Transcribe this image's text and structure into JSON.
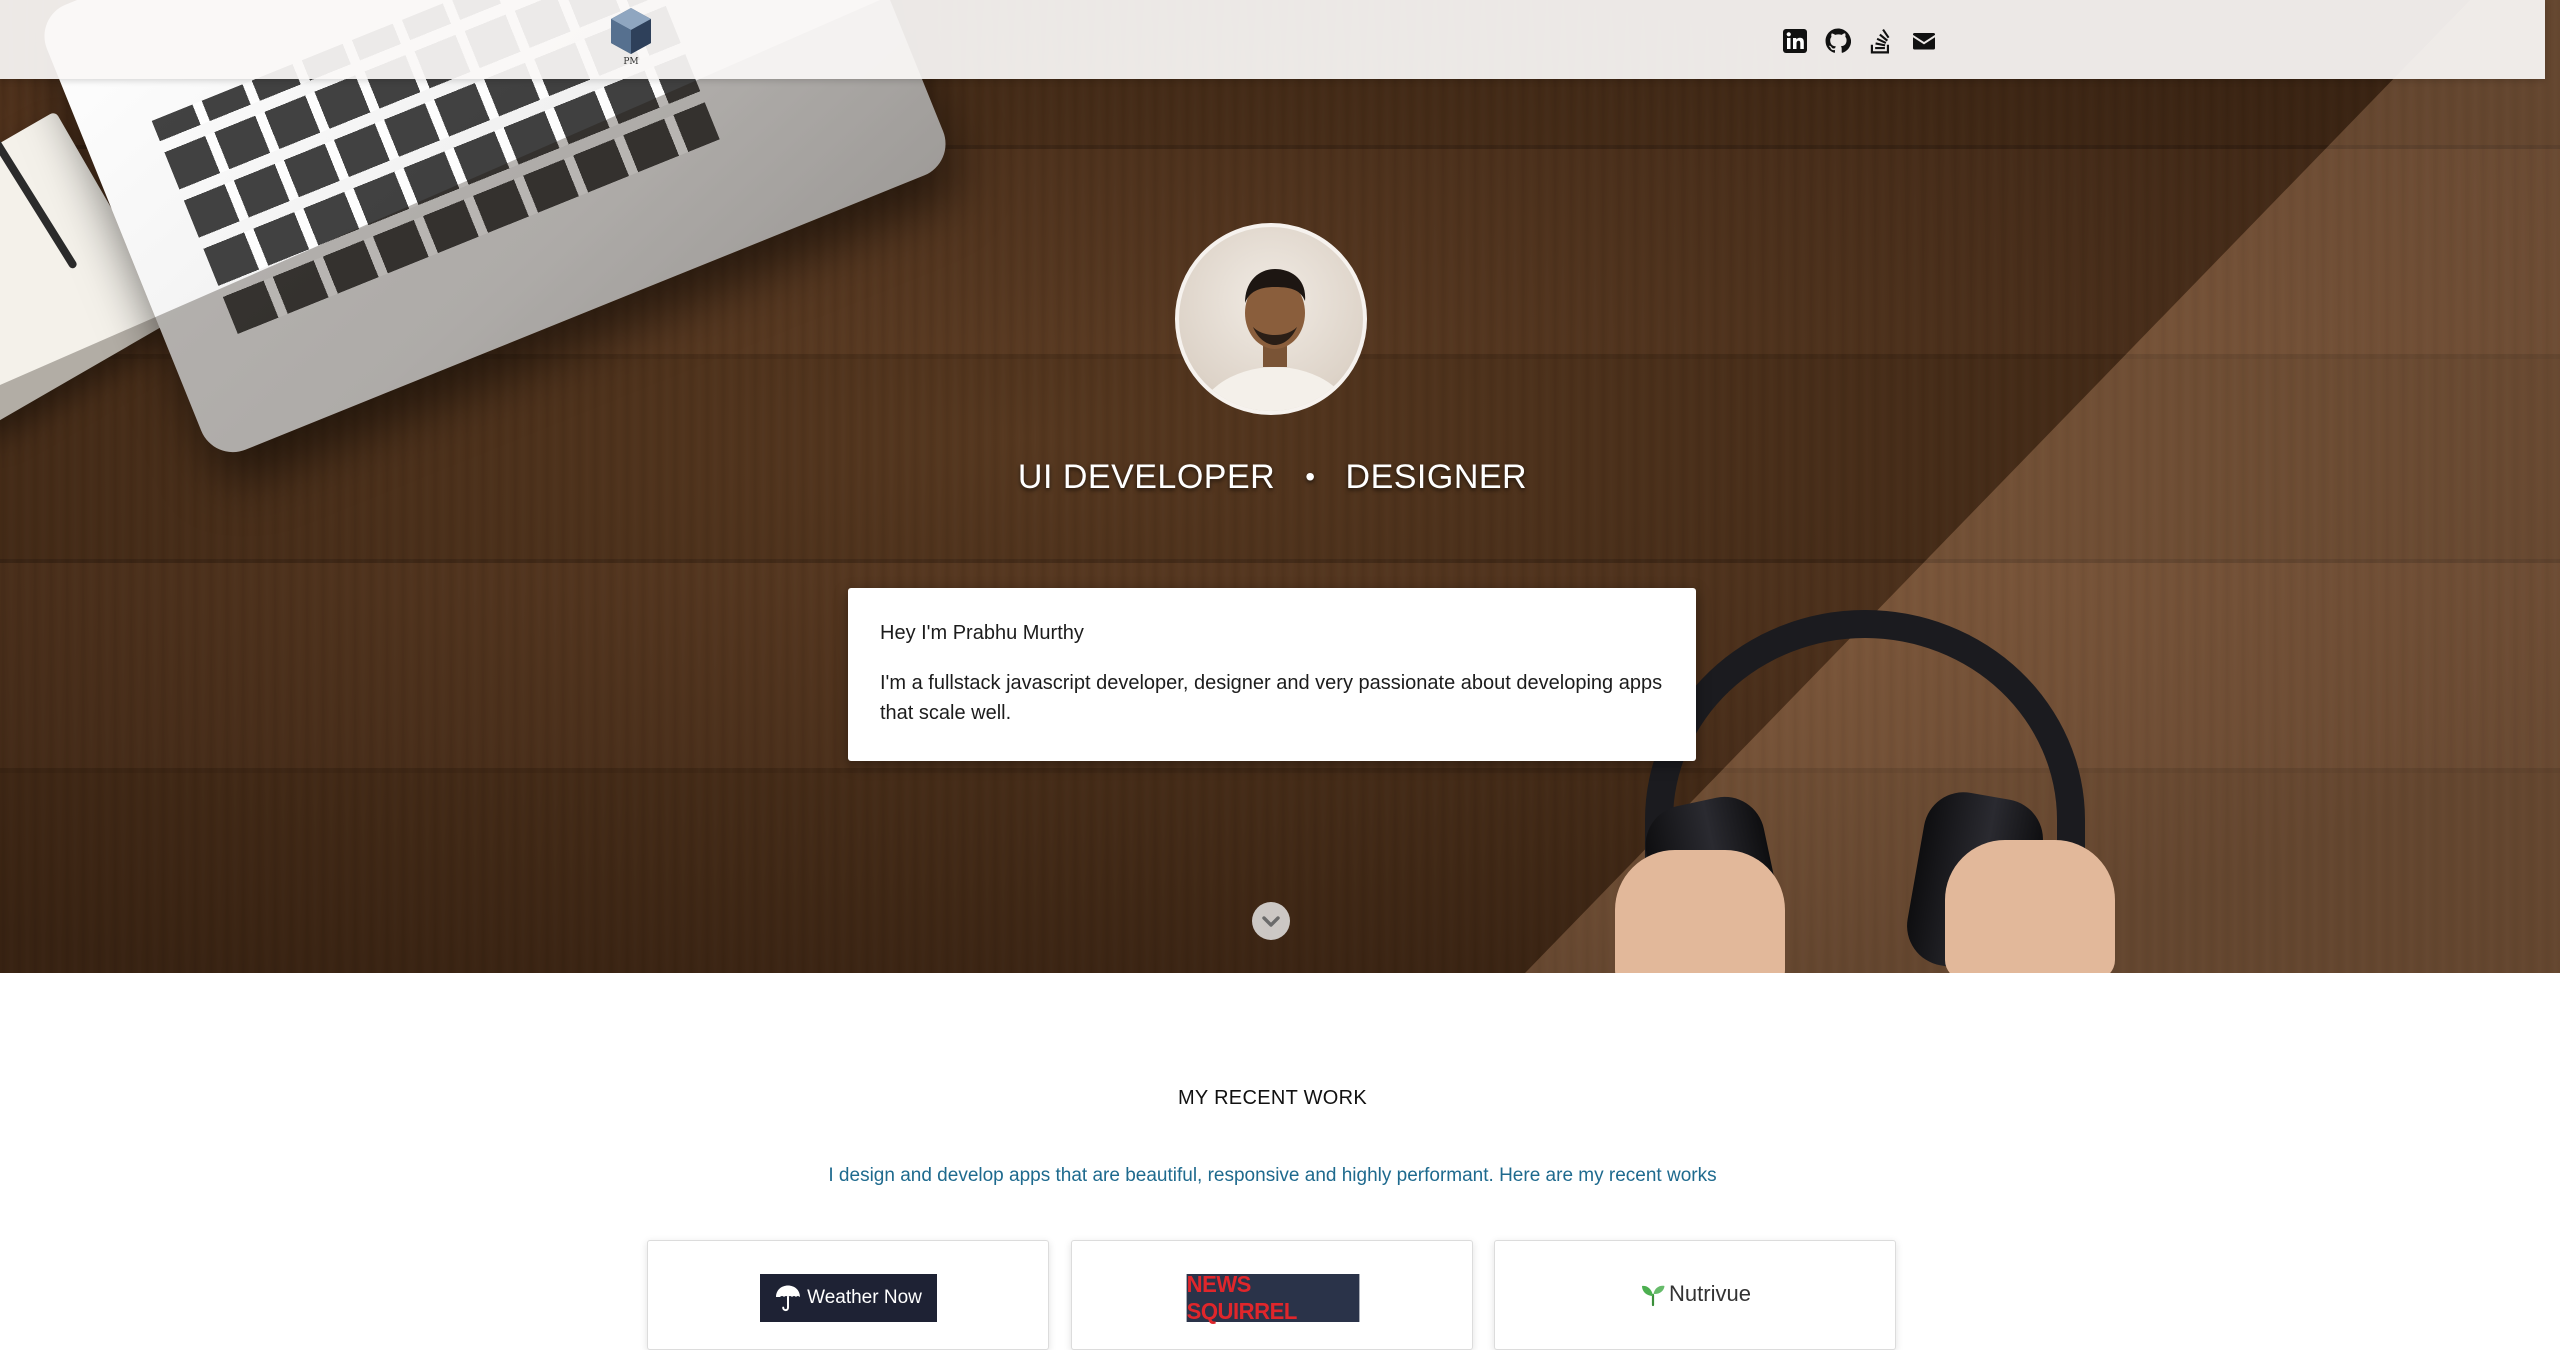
{
  "navbar": {
    "logo_text": "PM",
    "social_links": [
      {
        "name": "linkedin",
        "icon": "linkedin-icon"
      },
      {
        "name": "github",
        "icon": "github-icon"
      },
      {
        "name": "stackoverflow",
        "icon": "stackoverflow-icon"
      },
      {
        "name": "email",
        "icon": "envelope-icon"
      }
    ]
  },
  "hero": {
    "roles": [
      "UI DEVELOPER",
      "DESIGNER"
    ],
    "separator": "•",
    "greeting": "Hey I'm Prabhu Murthy",
    "bio": "I'm a fullstack javascript developer, designer and very passionate about developing apps that scale well.",
    "scroll_icon": "chevron-down-icon"
  },
  "recent_work": {
    "title": "MY RECENT WORK",
    "subtitle": "I design and develop apps that are beautiful, responsive and highly performant. Here are my recent works",
    "projects": [
      {
        "name": "Weather Now",
        "icon": "umbrella-icon"
      },
      {
        "name": "NEWS SQUIRREL"
      },
      {
        "name": "Nutrivue",
        "icon": "leaf-icon"
      }
    ]
  },
  "colors": {
    "accent_link": "#1e6a8e",
    "news_red": "#e0262b",
    "nutrivue_green": "#4caf50"
  }
}
